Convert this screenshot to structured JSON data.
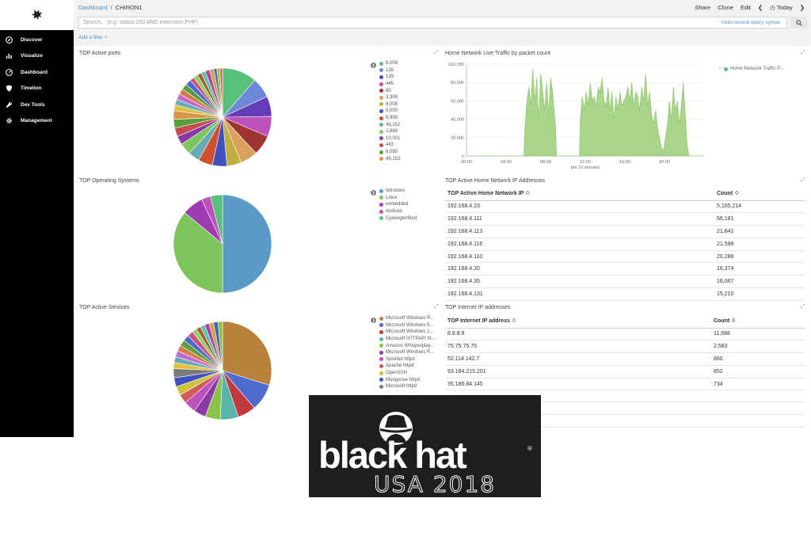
{
  "breadcrumb": {
    "parent": "Dashboard",
    "separator": "/",
    "current": "CHIRON1"
  },
  "top_actions": {
    "share": "Share",
    "clone": "Clone",
    "edit": "Edit",
    "today": "Today"
  },
  "search": {
    "placeholder": "Search... (e.g. status:200 AND extension:PHP)",
    "lucene_link": "Uses lucene query syntax"
  },
  "add_filter": "Add a filter +",
  "sidebar": {
    "items": [
      {
        "label": "Discover",
        "icon": "compass-icon"
      },
      {
        "label": "Visualize",
        "icon": "bar-chart-icon"
      },
      {
        "label": "Dashboard",
        "icon": "dashboard-icon"
      },
      {
        "label": "Timelion",
        "icon": "shield-icon"
      },
      {
        "label": "Dev Tools",
        "icon": "wrench-icon"
      },
      {
        "label": "Management",
        "icon": "gear-icon"
      }
    ]
  },
  "panels": {
    "ports": {
      "title": "TOP Active ports"
    },
    "traffic": {
      "title": "Home Network Live Traffic by packet count",
      "legend": "Home Network Traffic P..."
    },
    "os": {
      "title": "TOP Operating Systems"
    },
    "home_ips": {
      "title": "TOP Active Home Network IP Addresses",
      "col1": "TOP Active Home Network IP ♢",
      "col2": "Count ♢"
    },
    "services": {
      "title": "TOP Active Services"
    },
    "internet_ips": {
      "title": "TOP Internet IP addresses",
      "col1": "TOP Internet IP address ♢",
      "col2": "Count ♢"
    }
  },
  "ports_legend": [
    {
      "label": "8,009",
      "color": "#57c17b"
    },
    {
      "label": "135",
      "color": "#6f87d8"
    },
    {
      "label": "139",
      "color": "#663db8"
    },
    {
      "label": "445",
      "color": "#bc52bc"
    },
    {
      "label": "80",
      "color": "#9e3533"
    },
    {
      "label": "3,389",
      "color": "#daa05d"
    },
    {
      "label": "8,008",
      "color": "#bfaf40"
    },
    {
      "label": "9,000",
      "color": "#4050bd"
    },
    {
      "label": "9,999",
      "color": "#d0502d"
    },
    {
      "label": "49,152",
      "color": "#6aaab6"
    },
    {
      "label": "2,869",
      "color": "#7cc45b"
    },
    {
      "label": "10,001",
      "color": "#8a3aa4"
    },
    {
      "label": "443",
      "color": "#c44a55"
    },
    {
      "label": "8,089",
      "color": "#5a9e3a"
    },
    {
      "label": "49,153",
      "color": "#d9954b"
    }
  ],
  "os_legend": [
    {
      "label": "Windows",
      "color": "#5a9bc6"
    },
    {
      "label": "Linux",
      "color": "#7cc45b"
    },
    {
      "label": "embedded",
      "color": "#a03cb2"
    },
    {
      "label": "Android",
      "color": "#bc52bc"
    },
    {
      "label": "CyanogenMod",
      "color": "#57c17b"
    }
  ],
  "services_legend": [
    {
      "label": "Microsoft Windows R...",
      "color": "#b8823c"
    },
    {
      "label": "Microsoft Windows 9...",
      "color": "#4f6bd0"
    },
    {
      "label": "Microsoft Windows 1...",
      "color": "#c0393e"
    },
    {
      "label": "Microsoft HTTPAPI ht...",
      "color": "#56b5a8"
    },
    {
      "label": "Amazon Whisperplay...",
      "color": "#8bc34a"
    },
    {
      "label": "Microsoft Windows R...",
      "color": "#8a3aa4"
    },
    {
      "label": "Splunkd httpd",
      "color": "#bc52bc"
    },
    {
      "label": "Apache httpd",
      "color": "#d05a5a"
    },
    {
      "label": "OpenSSH",
      "color": "#c9c43c"
    },
    {
      "label": "Mongoose httpd",
      "color": "#4050bd"
    },
    {
      "label": "Microsoft httpd",
      "color": "#7a7a7a"
    }
  ],
  "home_ip_rows": [
    {
      "ip": "192.168.4.23",
      "count": "5,105,214"
    },
    {
      "ip": "192.168.4.111",
      "count": "56,181"
    },
    {
      "ip": "192.168.4.113",
      "count": "21,641"
    },
    {
      "ip": "192.168.4.116",
      "count": "21,598"
    },
    {
      "ip": "192.168.4.110",
      "count": "20,288"
    },
    {
      "ip": "192.168.4.20",
      "count": "18,374"
    },
    {
      "ip": "192.168.4.35",
      "count": "16,067"
    },
    {
      "ip": "192.168.4.131",
      "count": "15,210"
    }
  ],
  "internet_ip_rows": [
    {
      "ip": "8.8.8.8",
      "count": "11,688"
    },
    {
      "ip": "75.75.75.75",
      "count": "2,583"
    },
    {
      "ip": "52.114.142.7",
      "count": "860"
    },
    {
      "ip": "93.184.215.201",
      "count": "852"
    },
    {
      "ip": "35.185.84.145",
      "count": "734"
    }
  ],
  "chart_data": [
    {
      "type": "pie",
      "title": "TOP Active ports",
      "labels": [
        "8,009",
        "135",
        "139",
        "445",
        "80",
        "3,389",
        "8,008",
        "9,000",
        "9,999",
        "49,152",
        "2,869",
        "10,001",
        "443",
        "8,089",
        "49,153"
      ],
      "values": [
        12,
        7,
        7,
        7,
        7,
        6,
        5,
        5,
        5,
        4,
        4,
        3,
        3,
        3,
        3,
        2,
        2,
        2,
        2,
        2,
        2,
        1.5,
        1.5,
        1.5,
        1.5,
        1.5,
        1.5,
        1,
        1,
        1
      ]
    },
    {
      "type": "area",
      "title": "Home Network Live Traffic by packet count",
      "xlabel": "per 10 minutes",
      "ylabel": "",
      "x_ticks": [
        "00:00",
        "04:00",
        "08:00",
        "12:00",
        "16:00",
        "20:00"
      ],
      "ylim": [
        0,
        100000
      ],
      "y_ticks": [
        "0",
        "20,000",
        "40,000",
        "60,000",
        "80,000",
        "100,000"
      ],
      "series": [
        {
          "name": "Home Network Traffic P...",
          "x_hours": [
            0,
            5.8,
            5.9,
            6.1,
            6.3,
            6.5,
            6.7,
            6.9,
            7.1,
            7.3,
            7.5,
            7.7,
            7.9,
            8.1,
            8.3,
            8.5,
            8.7,
            9.0,
            9.1,
            11.4,
            11.5,
            11.7,
            11.9,
            12.1,
            12.3,
            12.5,
            12.7,
            12.9,
            13.1,
            13.3,
            13.5,
            13.7,
            13.9,
            14.1,
            14.3,
            14.5,
            14.7,
            14.9,
            15.1,
            15.3,
            15.5,
            15.7,
            15.9,
            16.1,
            16.3,
            16.5,
            16.7,
            16.9,
            17.1,
            17.3,
            17.5,
            17.7,
            17.9,
            18.1,
            18.3,
            18.5,
            18.7,
            18.9,
            19.1,
            19.3,
            19.5,
            19.7,
            19.9,
            20.1,
            20.3,
            20.5,
            20.7,
            20.9,
            21.1,
            21.3,
            21.5,
            21.7,
            21.9,
            22.1,
            22.3,
            22.5,
            24
          ],
          "values": [
            0,
            0,
            30000,
            60000,
            75000,
            55000,
            95000,
            60000,
            85000,
            40000,
            90000,
            70000,
            50000,
            80000,
            45000,
            85000,
            70000,
            30000,
            0,
            0,
            40000,
            65000,
            50000,
            70000,
            55000,
            80000,
            60000,
            65000,
            55000,
            75000,
            70000,
            85000,
            60000,
            55000,
            75000,
            50000,
            70000,
            40000,
            65000,
            50000,
            70000,
            55000,
            60000,
            65000,
            75000,
            60000,
            80000,
            55000,
            70000,
            65000,
            50000,
            75000,
            60000,
            90000,
            55000,
            70000,
            45000,
            35000,
            50000,
            30000,
            20000,
            10000,
            5000,
            20000,
            35000,
            60000,
            40000,
            75000,
            50000,
            60000,
            35000,
            55000,
            80000,
            45000,
            10000,
            0,
            0
          ]
        }
      ]
    },
    {
      "type": "pie",
      "title": "TOP Operating Systems",
      "labels": [
        "Windows",
        "Linux",
        "embedded",
        "Android",
        "CyanogenMod"
      ],
      "values": [
        50,
        36,
        7,
        3,
        4
      ]
    },
    {
      "type": "pie",
      "title": "TOP Active Services",
      "labels": [
        "Microsoft Windows R...",
        "Microsoft Windows 9...",
        "Microsoft Windows 1...",
        "Microsoft HTTPAPI ht...",
        "Amazon Whisperplay...",
        "Microsoft Windows R...",
        "Splunkd httpd",
        "Apache httpd",
        "OpenSSH",
        "Mongoose httpd",
        "Microsoft httpd"
      ],
      "values": [
        30,
        9,
        6,
        6,
        5,
        4,
        4,
        3,
        3,
        3,
        3,
        2,
        2,
        2,
        2,
        2,
        2,
        2,
        1.5,
        1.5,
        1.5,
        1.5,
        1.5,
        1.5,
        1.5
      ]
    }
  ],
  "banner": {
    "line1": "black hat",
    "line2": "USA 2018",
    "registered": "®"
  },
  "colors": {
    "sidebar": "#000000",
    "accent": "#4a90c8",
    "area_fill": "#a9d58b",
    "area_stroke": "#8cc26a"
  }
}
